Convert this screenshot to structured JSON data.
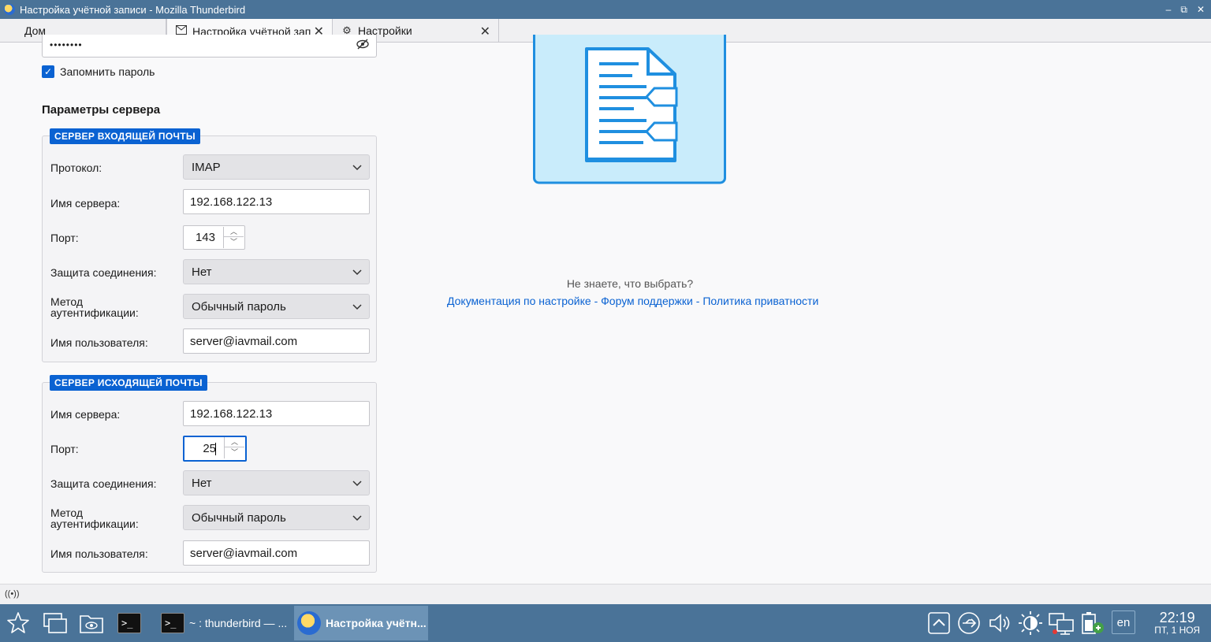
{
  "window": {
    "title": "Настройка учётной записи - Mozilla Thunderbird",
    "controls": [
      "‒",
      "⧉",
      "✕"
    ]
  },
  "tabs": [
    {
      "label": "Дом"
    },
    {
      "label": "Настройка учётной записи"
    },
    {
      "label": "Настройки"
    }
  ],
  "account": {
    "password_dots": "••••••••",
    "remember_label": "Запомнить пароль",
    "remember_checked": true
  },
  "server_params": {
    "title": "Параметры сервера",
    "incoming": {
      "legend": "СЕРВЕР ВХОДЯЩЕЙ ПОЧТЫ",
      "protocol_label": "Протокол:",
      "protocol_value": "IMAP",
      "hostname_label": "Имя сервера:",
      "hostname_value": "192.168.122.13",
      "port_label": "Порт:",
      "port_value": "143",
      "security_label": "Защита соединения:",
      "security_value": "Нет",
      "auth_label_1": "Метод",
      "auth_label_2": "аутентификации:",
      "auth_value": "Обычный пароль",
      "username_label": "Имя пользователя:",
      "username_value": "server@iavmail.com"
    },
    "outgoing": {
      "legend": "СЕРВЕР ИСХОДЯЩЕЙ ПОЧТЫ",
      "hostname_label": "Имя сервера:",
      "hostname_value": "192.168.122.13",
      "port_label": "Порт:",
      "port_value": "25",
      "security_label": "Защита соединения:",
      "security_value": "Нет",
      "auth_label_1": "Метод",
      "auth_label_2": "аутентификации:",
      "auth_value": "Обычный пароль",
      "username_label": "Имя пользователя:",
      "username_value": "server@iavmail.com"
    }
  },
  "help": {
    "question": "Не знаете, что выбрать?",
    "link_docs": "Документация по настройке",
    "link_forum": "Форум поддержки",
    "link_privacy": "Политика приватности",
    "separator": "-"
  },
  "taskbar": {
    "task1": "~ : thunderbird — ...",
    "task2": "Настройка учётн...",
    "lang": "en",
    "time": "22:19",
    "date": "ПТ, 1 НОЯ"
  },
  "colors": {
    "accent": "#0a62d2",
    "titlebar": "#4a7398"
  }
}
